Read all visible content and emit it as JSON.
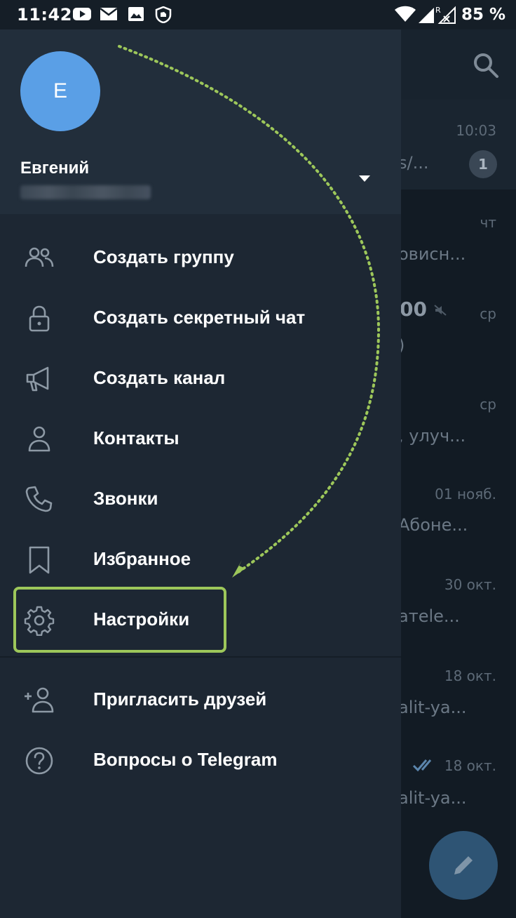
{
  "status_bar": {
    "time": "11:42",
    "battery": "85 %",
    "icons": [
      "youtube-icon",
      "mail-icon",
      "gallery-icon",
      "shield-icon",
      "wifi-icon",
      "signal-icon",
      "battery-icon"
    ]
  },
  "drawer": {
    "avatar_letter": "Е",
    "user_name": "Евгений",
    "menu": [
      {
        "id": "new-group",
        "label": "Создать группу",
        "icon": "group-icon"
      },
      {
        "id": "new-secret-chat",
        "label": "Создать секретный чат",
        "icon": "lock-icon"
      },
      {
        "id": "new-channel",
        "label": "Создать канал",
        "icon": "megaphone-icon"
      },
      {
        "id": "contacts",
        "label": "Контакты",
        "icon": "person-icon"
      },
      {
        "id": "calls",
        "label": "Звонки",
        "icon": "phone-icon"
      },
      {
        "id": "saved",
        "label": "Избранное",
        "icon": "bookmark-icon"
      },
      {
        "id": "settings",
        "label": "Настройки",
        "icon": "gear-icon"
      }
    ],
    "secondary_menu": [
      {
        "id": "invite",
        "label": "Пригласить друзей",
        "icon": "add-person-icon"
      },
      {
        "id": "faq",
        "label": "Вопросы о Telegram",
        "icon": "help-icon"
      }
    ]
  },
  "chat_list": {
    "rows": [
      {
        "time": "10:03",
        "snippet": "s/...",
        "unread": "1"
      },
      {
        "time": "чт",
        "snippet": "овисн..."
      },
      {
        "time": "ср",
        "snippet": ")",
        "title": "00"
      },
      {
        "time": "ср",
        "snippet": ", улуч..."
      },
      {
        "time": "01 нояб.",
        "snippet": "Абоне..."
      },
      {
        "time": "30 окт.",
        "snippet": "атele..."
      },
      {
        "time": "18 окт.",
        "snippet": "alit-ya..."
      },
      {
        "time": "18 окт.",
        "snippet": "alit-ya..."
      }
    ]
  },
  "colors": {
    "accent_avatar": "#5a9fe6",
    "highlight": "#9dc75a",
    "drawer_bg": "#1d2733"
  }
}
